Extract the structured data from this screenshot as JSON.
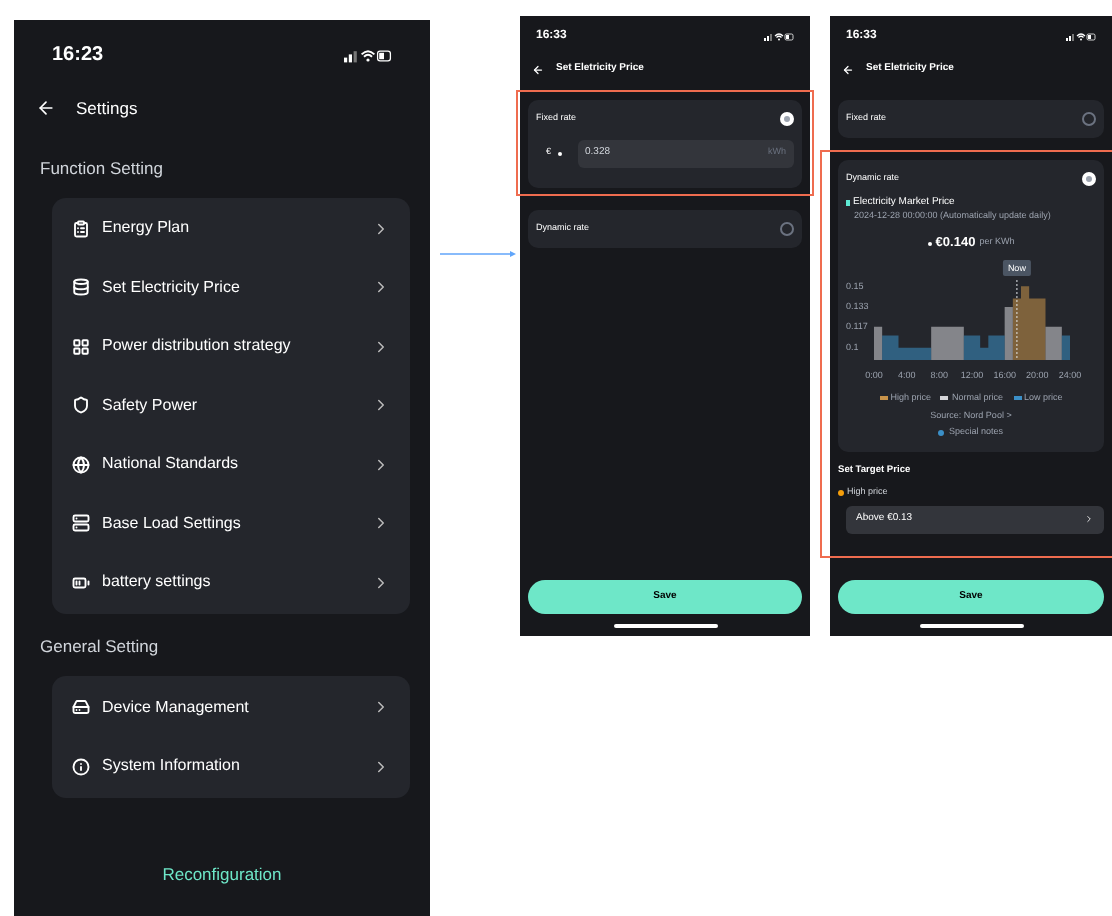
{
  "settings_screen": {
    "time": "16:23",
    "title": "Settings",
    "sections": [
      {
        "title": "Function Setting",
        "items": [
          {
            "label": "Energy Plan"
          },
          {
            "label": "Set Electricity Price"
          },
          {
            "label": "Power distribution strategy"
          },
          {
            "label": "Safety Power"
          },
          {
            "label": "National Standards"
          },
          {
            "label": "Base Load Settings"
          },
          {
            "label": "battery settings"
          }
        ]
      },
      {
        "title": "General Setting",
        "items": [
          {
            "label": "Device Management"
          },
          {
            "label": "System Information"
          }
        ]
      }
    ],
    "footer_button": "Reconfiguration"
  },
  "price_screens": [
    {
      "time": "16:33",
      "title": "Set Eletricity Price",
      "options": [
        {
          "label": "Fixed rate",
          "selected": true,
          "currency": "€",
          "value": "0.328",
          "unit": "kWh"
        },
        {
          "label": "Dynamic rate",
          "selected": false
        }
      ],
      "save_button": "Save"
    },
    {
      "time": "16:33",
      "title": "Set Eletricity Price",
      "options": [
        {
          "label": "Fixed rate",
          "selected": false
        },
        {
          "label": "Dynamic rate",
          "selected": true,
          "market": {
            "title": "Electricity Market Price",
            "date": "2024-12-28 00:00:00 (Automatically update daily)",
            "price": "€0.140",
            "price_unit": "per KWh",
            "chart_data": {
              "type": "area",
              "x": [
                0.5,
                1.5,
                2.5,
                3.5,
                4.5,
                5.5,
                6.5,
                7.5,
                8.5,
                9.5,
                10.5,
                11.5,
                12.5,
                13.5,
                14.5,
                15.5,
                16.5,
                17.5,
                18.5,
                19.5,
                20.5,
                21.5,
                22.5,
                23.5
              ],
              "xlim": [
                0,
                24
              ],
              "ylim": [
                0.09,
                0.155
              ],
              "xticks": [
                {
                  "value": 0,
                  "label": "0:00"
                },
                {
                  "value": 4,
                  "label": "4:00"
                },
                {
                  "value": 8,
                  "label": "8:00"
                },
                {
                  "value": 12,
                  "label": "12:00"
                },
                {
                  "value": 16,
                  "label": "16:00"
                },
                {
                  "value": 20,
                  "label": "20:00"
                },
                {
                  "value": 24,
                  "label": "24:00"
                }
              ],
              "yticks": [
                0.1,
                {
                  "value": 0.117,
                  "label": "0.117"
                },
                {
                  "value": 0.133,
                  "label": "0.133"
                },
                0.15
              ],
              "series": [
                {
                  "name": "High price",
                  "color": "#c8934a",
                  "values": [
                    null,
                    null,
                    null,
                    null,
                    null,
                    null,
                    null,
                    null,
                    null,
                    null,
                    null,
                    null,
                    null,
                    null,
                    null,
                    null,
                    null,
                    0.14,
                    0.15,
                    0.14,
                    0.14,
                    null,
                    null,
                    null
                  ]
                },
                {
                  "name": "Normal price",
                  "color": "#d4d4d8",
                  "values": [
                    0.117,
                    null,
                    null,
                    null,
                    null,
                    null,
                    null,
                    0.117,
                    0.117,
                    0.117,
                    0.117,
                    null,
                    null,
                    null,
                    null,
                    null,
                    0.133,
                    null,
                    null,
                    null,
                    null,
                    0.117,
                    0.117,
                    null
                  ]
                },
                {
                  "name": "Low price",
                  "color": "#3b8fc7",
                  "values": [
                    null,
                    0.11,
                    0.11,
                    0.1,
                    0.1,
                    0.1,
                    0.1,
                    null,
                    null,
                    null,
                    null,
                    0.11,
                    0.11,
                    0.1,
                    0.11,
                    0.11,
                    null,
                    null,
                    null,
                    null,
                    null,
                    null,
                    null,
                    0.11
                  ]
                }
              ],
              "annotations": [
                {
                  "x": 17.5,
                  "text": "Now"
                }
              ]
            },
            "source": "Source: Nord Pool >",
            "notes": "Special notes"
          }
        }
      ],
      "target": {
        "title": "Set Target Price",
        "level_label": "High price",
        "field_value": "Above €0.13"
      },
      "save_button": "Save"
    }
  ]
}
